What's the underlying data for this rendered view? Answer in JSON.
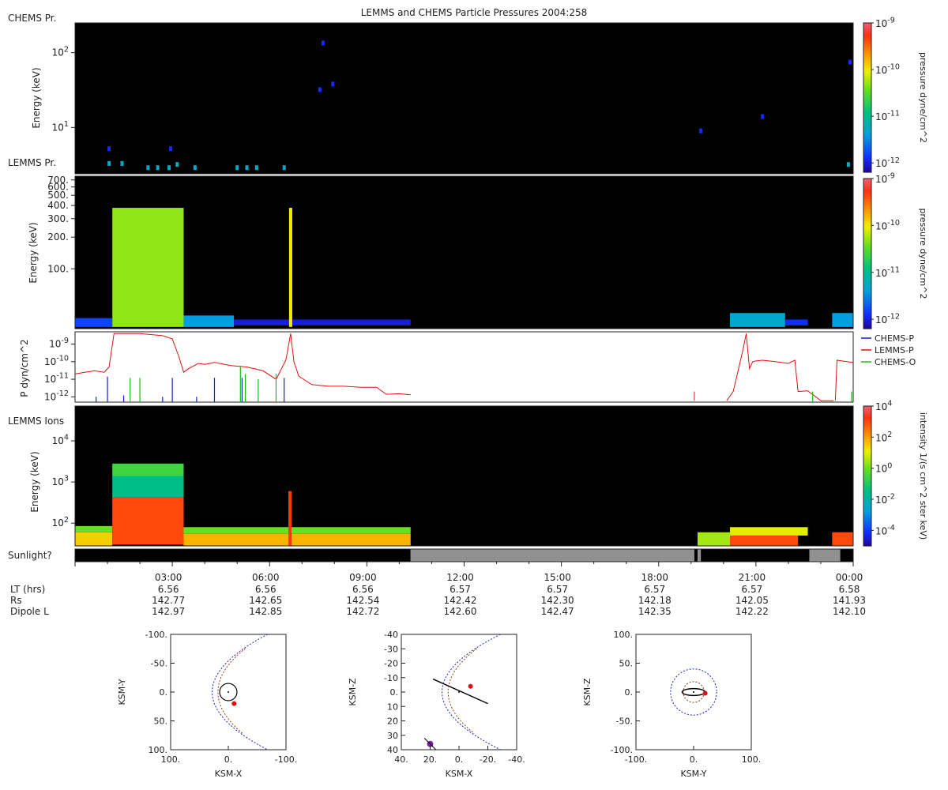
{
  "title": "LEMMS and CHEMS Particle Pressures  2004:258",
  "panel_labels": {
    "chems": "CHEMS Pr.",
    "lemms_pr": "LEMMS Pr.",
    "lemms_ions": "LEMMS Ions",
    "sunlight": "Sunlight?"
  },
  "colors": {
    "chems_p": "#1020c8",
    "lemms_p": "#e01010",
    "chems_o": "#10c010",
    "sunlit": "#909090",
    "dark": "#000000"
  },
  "chart_data": [
    {
      "type": "heatmap",
      "name": "CHEMS pressure spectrogram",
      "ylabel": "Energy (keV)",
      "yscale": "log",
      "ylim": [
        2.4,
        250
      ],
      "y_ticks": [
        "10^1",
        "10^2"
      ],
      "colorbar": {
        "label": "pressure dyne/cm^2",
        "ticks": [
          "10^-12",
          "10^-11",
          "10^-10",
          "10^-9"
        ],
        "range": [
          -12.2,
          -9
        ]
      },
      "points": [
        {
          "t": 1.05,
          "e": 5.2,
          "lv": -11.9
        },
        {
          "t": 1.05,
          "e": 3.3,
          "lv": -11.3
        },
        {
          "t": 1.45,
          "e": 3.3,
          "lv": -11.3
        },
        {
          "t": 2.25,
          "e": 2.9,
          "lv": -11.3
        },
        {
          "t": 2.55,
          "e": 2.9,
          "lv": -11.3
        },
        {
          "t": 2.9,
          "e": 2.9,
          "lv": -11.3
        },
        {
          "t": 3.15,
          "e": 3.2,
          "lv": -11.2
        },
        {
          "t": 2.95,
          "e": 5.2,
          "lv": -11.9
        },
        {
          "t": 3.7,
          "e": 2.9,
          "lv": -11.3
        },
        {
          "t": 5.0,
          "e": 2.9,
          "lv": -11.3
        },
        {
          "t": 5.3,
          "e": 2.9,
          "lv": -11.3
        },
        {
          "t": 5.6,
          "e": 2.9,
          "lv": -11.3
        },
        {
          "t": 6.45,
          "e": 2.9,
          "lv": -11.3
        },
        {
          "t": 7.55,
          "e": 32,
          "lv": -11.9
        },
        {
          "t": 7.65,
          "e": 135,
          "lv": -11.9
        },
        {
          "t": 7.95,
          "e": 38,
          "lv": -11.9
        },
        {
          "t": 19.3,
          "e": 9,
          "lv": -11.9
        },
        {
          "t": 21.2,
          "e": 14,
          "lv": -11.9
        },
        {
          "t": 23.85,
          "e": 3.2,
          "lv": -11.2
        },
        {
          "t": 23.9,
          "e": 75,
          "lv": -11.9
        }
      ]
    },
    {
      "type": "heatmap",
      "name": "LEMMS pressure spectrogram",
      "ylabel": "Energy (keV)",
      "yscale": "log",
      "ylim": [
        27,
        760
      ],
      "y_ticks": [
        "100.",
        "200.",
        "300.",
        "400.",
        "500.",
        "600.",
        "700."
      ],
      "colorbar": {
        "label": "pressure dyne/cm^2",
        "ticks": [
          "10^-12",
          "10^-11",
          "10^-10",
          "10^-9"
        ],
        "range": [
          -12.2,
          -9
        ]
      },
      "blocks": [
        {
          "t0": 0.0,
          "t1": 1.15,
          "e0": 28,
          "e1": 34,
          "lv": -11.8
        },
        {
          "t0": 1.15,
          "t1": 3.35,
          "e0": 28,
          "e1": 380,
          "lv": -10.3
        },
        {
          "t0": 3.35,
          "t1": 4.9,
          "e0": 28,
          "e1": 36,
          "lv": -11.4
        },
        {
          "t0": 4.9,
          "t1": 10.35,
          "e0": 29,
          "e1": 33,
          "lv": -12.0
        },
        {
          "t0": 6.6,
          "t1": 6.7,
          "e0": 28,
          "e1": 380,
          "lv": -10.0
        },
        {
          "t0": 20.2,
          "t1": 21.9,
          "e0": 28,
          "e1": 38,
          "lv": -11.3
        },
        {
          "t0": 21.9,
          "t1": 22.6,
          "e0": 29,
          "e1": 33,
          "lv": -11.9
        },
        {
          "t0": 23.35,
          "t1": 24.0,
          "e0": 28,
          "e1": 38,
          "lv": -11.4
        }
      ]
    },
    {
      "type": "line",
      "name": "Partial pressures",
      "ylabel": "P dyn/cm^2",
      "yscale": "log",
      "ylim": [
        5e-13,
        5e-09
      ],
      "y_ticks": [
        "10^-12",
        "10^-11",
        "10^-10",
        "10^-9"
      ],
      "x_unit": "hours",
      "series": [
        {
          "name": "CHEMS-P",
          "color": "#1020c8",
          "style": "spikes",
          "x": [
            0.65,
            1.0,
            1.5,
            2.7,
            3.0,
            3.75,
            4.3,
            5.15,
            6.45
          ],
          "y": [
            1e-12,
            1.4e-11,
            1.2e-12,
            1e-12,
            1.2e-11,
            1e-12,
            1.2e-11,
            1.2e-11,
            1.2e-11
          ]
        },
        {
          "name": "LEMMS-P",
          "color": "#e01010",
          "style": "line",
          "segments": [
            {
              "x": [
                0.0,
                0.3,
                0.6,
                0.9,
                1.05,
                1.15,
                1.2,
                2.0,
                2.7,
                3.0,
                3.2,
                3.35,
                3.5,
                3.8,
                4.0,
                4.3,
                4.8,
                5.3,
                5.8,
                6.2,
                6.5,
                6.65,
                6.75,
                6.9,
                7.3,
                7.8,
                8.3,
                8.8,
                9.3,
                9.6,
                10.0,
                10.35
              ],
              "y": [
                2e-11,
                2.5e-11,
                3e-11,
                2.5e-11,
                5e-11,
                9e-10,
                4e-09,
                4e-09,
                3e-09,
                2e-09,
                2e-10,
                2.5e-11,
                4e-11,
                8e-11,
                7e-11,
                9e-11,
                6e-11,
                5e-11,
                3e-11,
                1e-11,
                1.2e-10,
                4e-09,
                1e-10,
                1.5e-11,
                5e-12,
                4e-12,
                4e-12,
                3.5e-12,
                3.5e-12,
                1.4e-12,
                1.5e-12,
                1.3e-12
              ]
            },
            {
              "x": [
                19.1,
                19.1
              ],
              "y": [
                6e-13,
                2e-12
              ]
            },
            {
              "x": [
                20.1,
                20.3,
                20.45,
                20.6,
                20.7,
                20.8,
                20.9,
                21.0,
                21.2,
                21.6,
                22.0,
                22.2,
                22.3,
                22.6,
                23.0,
                23.4
              ],
              "y": [
                6e-13,
                2e-12,
                3e-11,
                5e-10,
                4e-09,
                4e-11,
                1e-10,
                1.1e-10,
                1.2e-10,
                1e-10,
                8e-11,
                1.2e-10,
                2e-12,
                2.2e-12,
                6e-13,
                6e-13
              ]
            },
            {
              "x": [
                23.45,
                23.5,
                23.8,
                24.0
              ],
              "y": [
                6e-13,
                1.2e-10,
                1e-10,
                9e-11
              ]
            }
          ]
        },
        {
          "name": "CHEMS-O",
          "color": "#10c010",
          "style": "spikes",
          "x": [
            1.7,
            2.0,
            5.1,
            5.25,
            5.65,
            6.2,
            22.75,
            23.95
          ],
          "y": [
            1.2e-11,
            1.2e-11,
            5e-11,
            2e-11,
            1e-11,
            2e-11,
            2e-12,
            2e-12
          ]
        }
      ]
    },
    {
      "type": "heatmap",
      "name": "LEMMS ion intensity spectrogram",
      "ylabel": "Energy (keV)",
      "yscale": "log",
      "ylim": [
        28,
        70000
      ],
      "y_ticks": [
        "10^2",
        "10^3",
        "10^4"
      ],
      "colorbar": {
        "label": "intensity 1/(s cm^2 ster keV)",
        "ticks": [
          "10^-4",
          "10^-2",
          "10^0",
          "10^2",
          "10^4"
        ],
        "range": [
          -5,
          4
        ]
      },
      "blocks": [
        {
          "t0": 0.0,
          "t1": 1.15,
          "e0": 28,
          "e1": 60,
          "lv": 1.5
        },
        {
          "t0": 0.0,
          "t1": 1.15,
          "e0": 60,
          "e1": 85,
          "lv": 0.0
        },
        {
          "t0": 1.15,
          "t1": 3.35,
          "e0": 30,
          "e1": 420,
          "lv": 3.0
        },
        {
          "t0": 1.15,
          "t1": 3.35,
          "e0": 420,
          "e1": 1400,
          "lv": -1.5
        },
        {
          "t0": 1.15,
          "t1": 3.35,
          "e0": 1400,
          "e1": 2800,
          "lv": -0.5
        },
        {
          "t0": 3.35,
          "t1": 10.35,
          "e0": 28,
          "e1": 55,
          "lv": 1.8
        },
        {
          "t0": 3.35,
          "t1": 10.35,
          "e0": 55,
          "e1": 80,
          "lv": 0.0
        },
        {
          "t0": 19.2,
          "t1": 20.2,
          "e0": 28,
          "e1": 60,
          "lv": 0.5
        },
        {
          "t0": 20.2,
          "t1": 22.3,
          "e0": 28,
          "e1": 50,
          "lv": 3.0
        },
        {
          "t0": 20.2,
          "t1": 22.6,
          "e0": 50,
          "e1": 80,
          "lv": 1.0
        },
        {
          "t0": 23.35,
          "t1": 24.0,
          "e0": 28,
          "e1": 60,
          "lv": 3.0
        },
        {
          "t0": 6.58,
          "t1": 6.68,
          "e0": 28,
          "e1": 600,
          "lv": 3.2
        }
      ]
    },
    {
      "type": "bar",
      "name": "Sunlight",
      "segments": [
        {
          "t0": 0.0,
          "t1": 10.35,
          "sunlit": false
        },
        {
          "t0": 10.35,
          "t1": 19.1,
          "sunlit": true
        },
        {
          "t0": 19.1,
          "t1": 19.2,
          "sunlit": false
        },
        {
          "t0": 19.2,
          "t1": 19.3,
          "sunlit": true
        },
        {
          "t0": 19.3,
          "t1": 22.65,
          "sunlit": false
        },
        {
          "t0": 22.65,
          "t1": 23.6,
          "sunlit": true
        },
        {
          "t0": 23.6,
          "t1": 24.0,
          "sunlit": false
        }
      ]
    },
    {
      "type": "scatter",
      "name": "KSM X-Y orbit",
      "xlabel": "KSM-X",
      "ylabel": "KSM-Y",
      "xlim": [
        100,
        -100
      ],
      "ylim": [
        -100,
        100
      ],
      "x_ticks": [
        "100.",
        "0.",
        "-100."
      ],
      "y_ticks": [
        "-100.",
        "-50.",
        "0.",
        "50.",
        "100."
      ],
      "spacecraft": {
        "x": -10,
        "y": 20
      }
    },
    {
      "type": "scatter",
      "name": "KSM X-Z orbit",
      "xlabel": "KSM-X",
      "ylabel": "KSM-Z",
      "xlim": [
        40,
        -40
      ],
      "ylim": [
        -40,
        40
      ],
      "x_ticks": [
        "40.",
        "20.",
        "0.",
        "-20.",
        "-40."
      ],
      "y_ticks": [
        "40",
        "30",
        "20",
        "10",
        "0.",
        "-10",
        "-20",
        "-30",
        "-40"
      ],
      "spacecraft": {
        "x": -8,
        "y": -4
      }
    },
    {
      "type": "scatter",
      "name": "KSM Y-Z orbit",
      "xlabel": "KSM-Y",
      "ylabel": "KSM-Z",
      "xlim": [
        -100,
        100
      ],
      "ylim": [
        100,
        -100
      ],
      "x_ticks": [
        "-100.",
        "0.",
        "100."
      ],
      "y_ticks": [
        "100.",
        "50.",
        "0.",
        "-50.",
        "-100."
      ],
      "spacecraft": {
        "x": 20,
        "y": -2
      }
    }
  ],
  "ephemeris": {
    "times": [
      "03:00",
      "06:00",
      "09:00",
      "12:00",
      "15:00",
      "18:00",
      "21:00",
      "00:00"
    ],
    "rows": [
      {
        "label": "LT (hrs)",
        "values": [
          "6.56",
          "6.56",
          "6.56",
          "6.57",
          "6.57",
          "6.57",
          "6.57",
          "6.58"
        ]
      },
      {
        "label": "Rs",
        "values": [
          "142.77",
          "142.65",
          "142.54",
          "142.42",
          "142.30",
          "142.18",
          "142.05",
          "141.93"
        ]
      },
      {
        "label": "Dipole L",
        "values": [
          "142.97",
          "142.85",
          "142.72",
          "142.60",
          "142.47",
          "142.35",
          "142.22",
          "142.10"
        ]
      }
    ]
  }
}
